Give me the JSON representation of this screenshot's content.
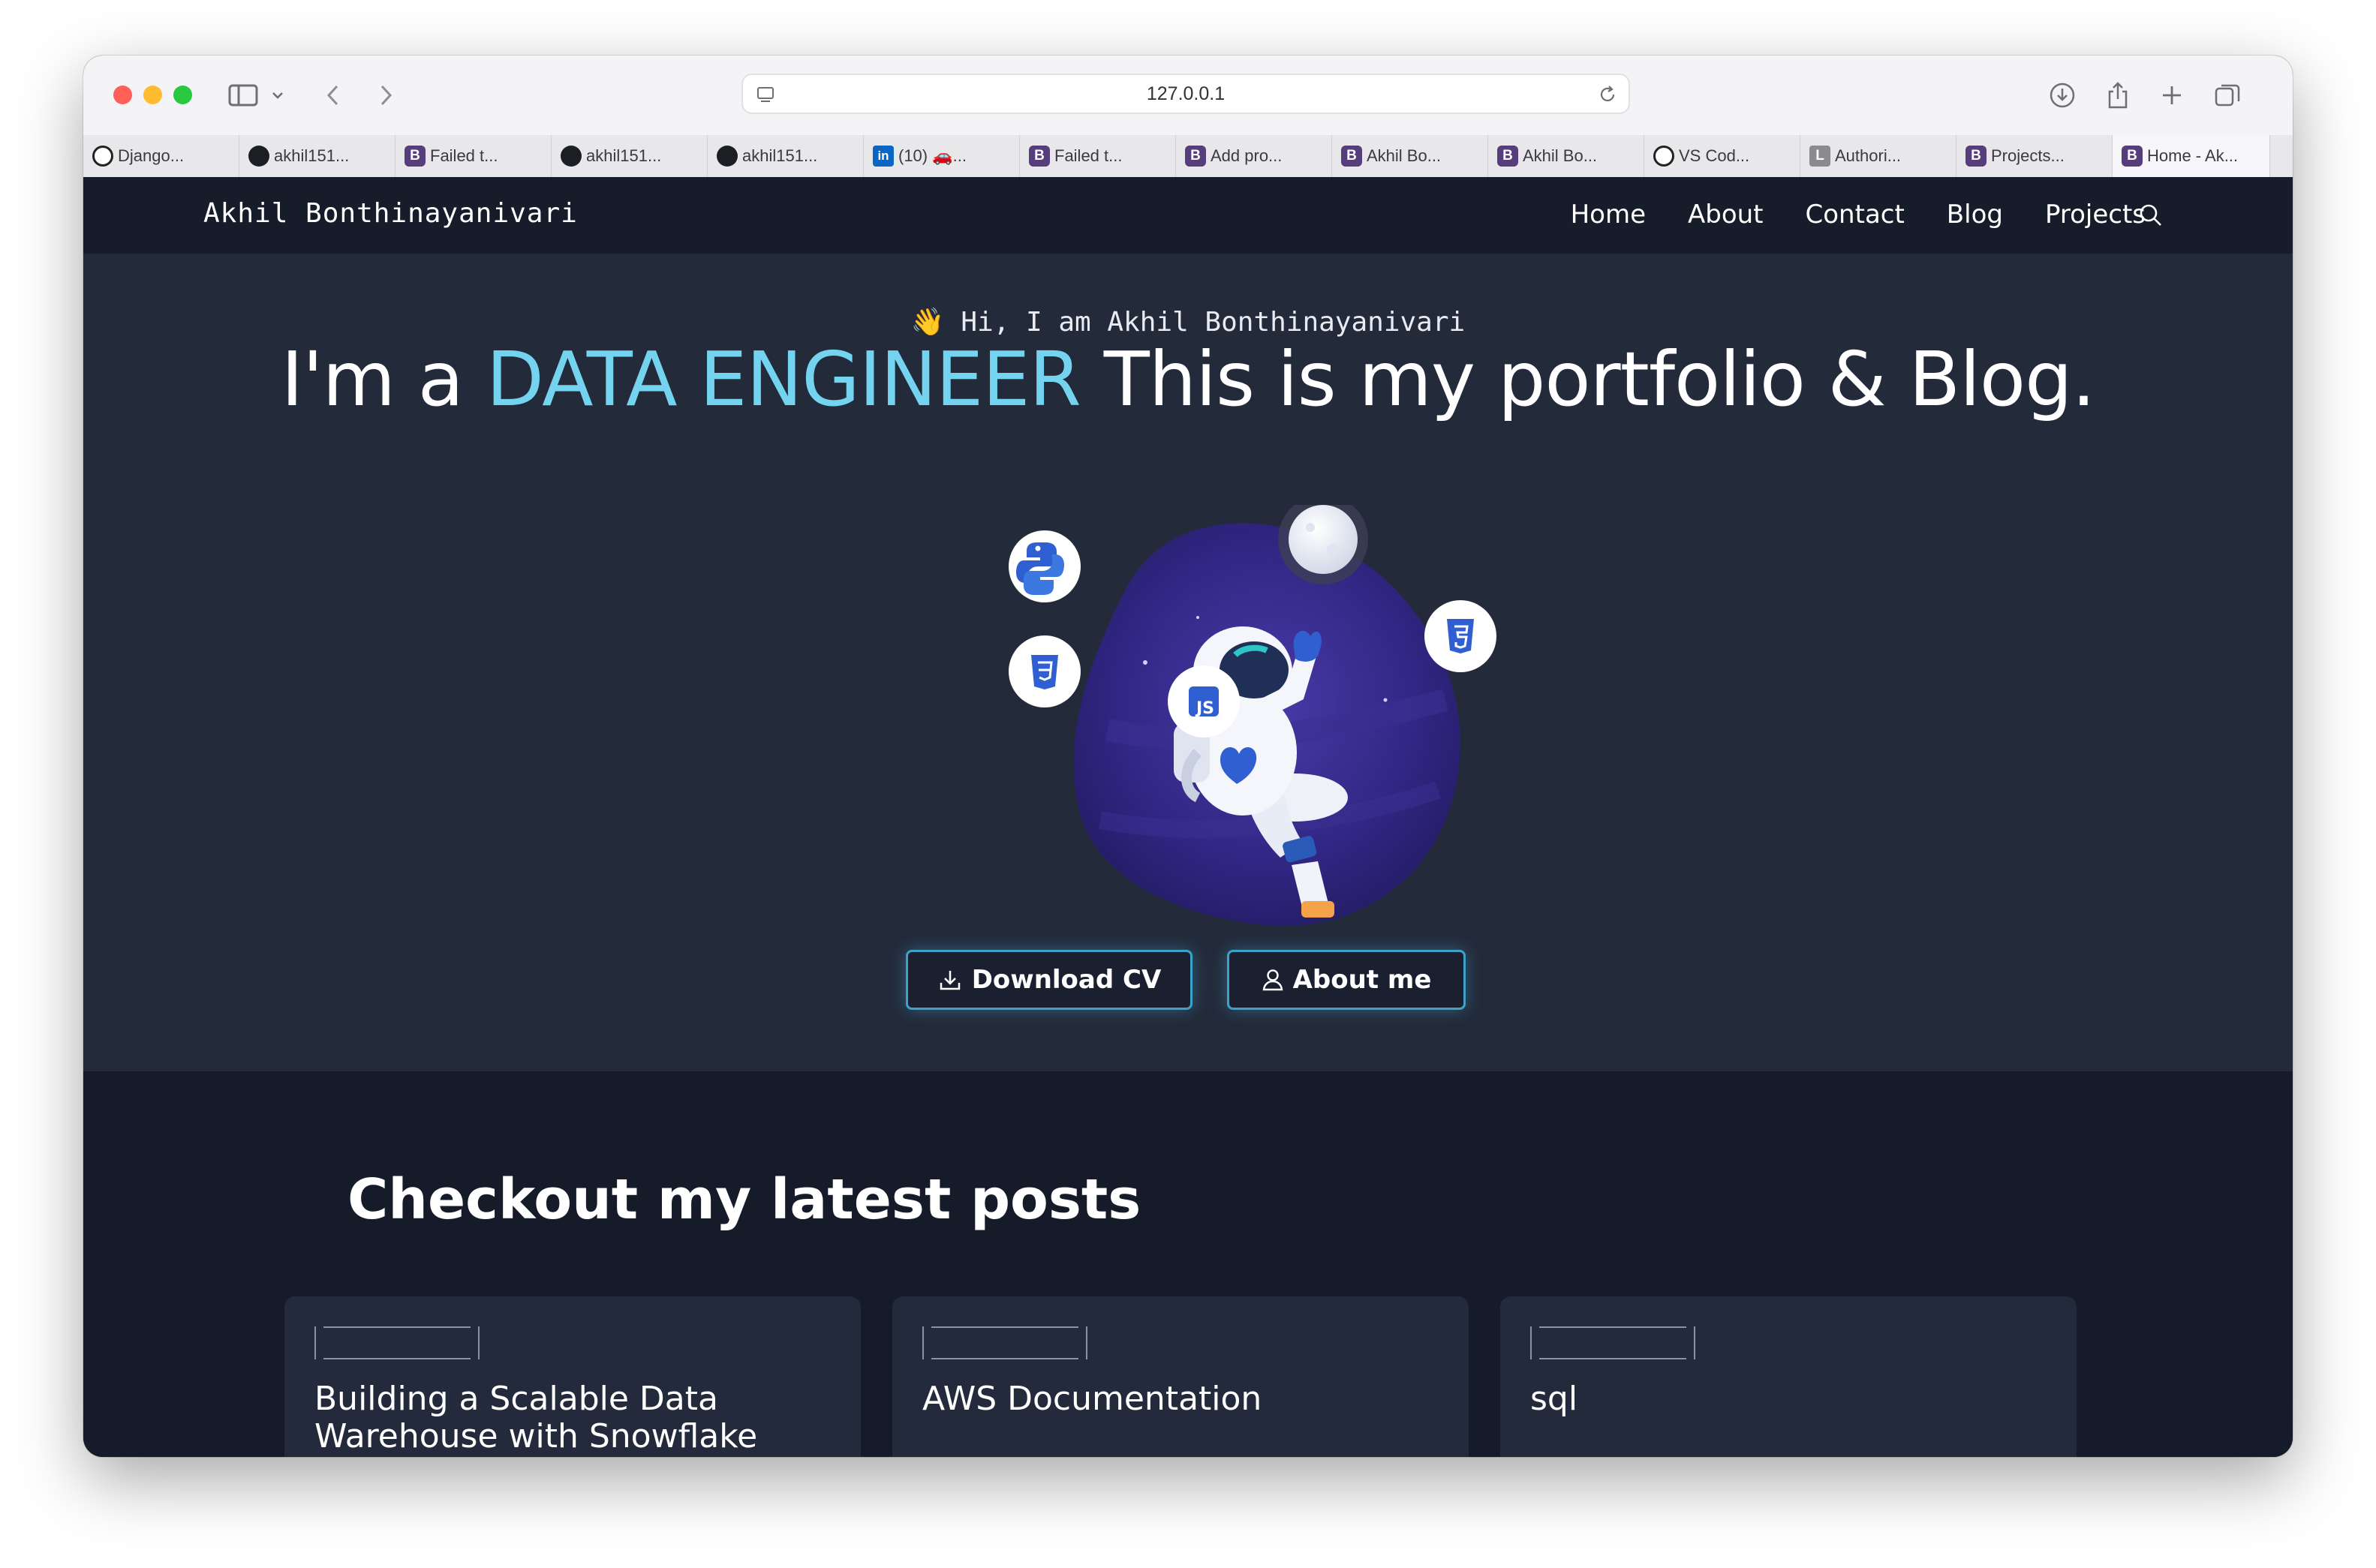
{
  "browser": {
    "url": "127.0.0.1",
    "tabs": [
      {
        "label": "Django...",
        "favicon": "django-icon"
      },
      {
        "label": "akhil151...",
        "favicon": "github-icon"
      },
      {
        "label": "Failed t...",
        "favicon": "bootstrap-icon"
      },
      {
        "label": "akhil151...",
        "favicon": "github-icon"
      },
      {
        "label": "akhil151...",
        "favicon": "github-icon"
      },
      {
        "label": "(10) 🚗...",
        "favicon": "linkedin-icon"
      },
      {
        "label": "Failed t...",
        "favicon": "bootstrap-icon"
      },
      {
        "label": "Add pro...",
        "favicon": "bootstrap-icon"
      },
      {
        "label": "Akhil Bo...",
        "favicon": "bootstrap-icon"
      },
      {
        "label": "Akhil Bo...",
        "favicon": "bootstrap-icon"
      },
      {
        "label": "VS Cod...",
        "favicon": "openai-icon"
      },
      {
        "label": "Authori...",
        "favicon": "letter-l-icon"
      },
      {
        "label": "Projects...",
        "favicon": "bootstrap-icon"
      },
      {
        "label": "Home - Ak...",
        "favicon": "bootstrap-icon",
        "active": true
      }
    ]
  },
  "nav": {
    "brand": "Akhil Bonthinayanivari",
    "links": [
      "Home",
      "About",
      "Contact",
      "Blog",
      "Projects"
    ]
  },
  "hero": {
    "greeting_emoji": "👋",
    "greeting": "Hi, I am Akhil Bonthinayanivari",
    "headline_prefix": "I'm a ",
    "headline_accent": "DATA ENGINEER",
    "headline_suffix": " This is my portfolio & Blog.",
    "buttons": {
      "download_cv": "Download CV",
      "about_me": "About me"
    },
    "badge_js": "JS"
  },
  "posts": {
    "title": "Checkout my latest posts",
    "cards": [
      {
        "title": "Building a Scalable Data Warehouse with Snowflake"
      },
      {
        "title": "AWS Documentation"
      },
      {
        "title": "sql"
      }
    ]
  },
  "colors": {
    "accent": "#74d4f0",
    "hero_bg": "#232a3a",
    "nav_bg": "#161c2a",
    "posts_bg": "#151b28",
    "button_border": "#3ea2c8"
  }
}
